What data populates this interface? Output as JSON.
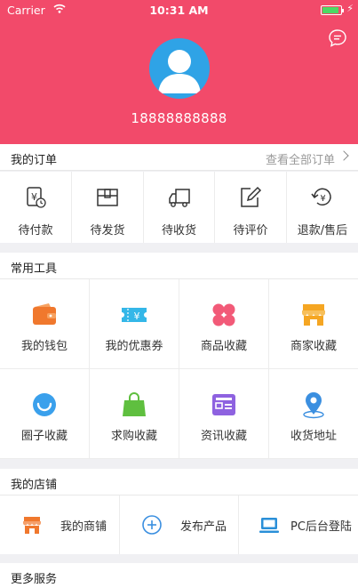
{
  "status_bar": {
    "carrier": "Carrier",
    "time": "10:31 AM",
    "battery_level": 0.9
  },
  "profile": {
    "phone": "18888888888"
  },
  "orders": {
    "title": "我的订单",
    "view_all": "查看全部订单",
    "items": [
      {
        "label": "待付款",
        "icon": "pending-payment-icon"
      },
      {
        "label": "待发货",
        "icon": "pending-shipment-icon"
      },
      {
        "label": "待收货",
        "icon": "pending-receipt-icon"
      },
      {
        "label": "待评价",
        "icon": "pending-review-icon"
      },
      {
        "label": "退款/售后",
        "icon": "refund-icon"
      }
    ]
  },
  "tools": {
    "title": "常用工具",
    "items": [
      {
        "label": "我的钱包",
        "icon": "wallet-icon",
        "color": "#f0782d"
      },
      {
        "label": "我的优惠券",
        "icon": "coupon-icon",
        "color": "#34b7e8"
      },
      {
        "label": "商品收藏",
        "icon": "product-favorites-icon",
        "color": "#f25a78"
      },
      {
        "label": "商家收藏",
        "icon": "store-favorites-icon",
        "color": "#f5a623"
      },
      {
        "label": "圈子收藏",
        "icon": "circle-favorites-icon",
        "color": "#3aa0ec"
      },
      {
        "label": "求购收藏",
        "icon": "shopping-bag-icon",
        "color": "#5fbf3f"
      },
      {
        "label": "资讯收藏",
        "icon": "news-icon",
        "color": "#8e62e0"
      },
      {
        "label": "收货地址",
        "icon": "location-icon",
        "color": "#3b8fe0"
      }
    ]
  },
  "shop": {
    "title": "我的店铺",
    "items": [
      {
        "label": "我的商铺",
        "icon": "shop-icon",
        "color": "#f0782d"
      },
      {
        "label": "发布产品",
        "icon": "add-icon",
        "color": "#3b8fe0"
      },
      {
        "label": "PC后台登陆",
        "icon": "computer-icon",
        "color": "#2a8fd8"
      }
    ]
  },
  "more": {
    "title": "更多服务"
  },
  "colors": {
    "brand": "#f24a6a",
    "avatar_bg": "#2fa3e6"
  }
}
